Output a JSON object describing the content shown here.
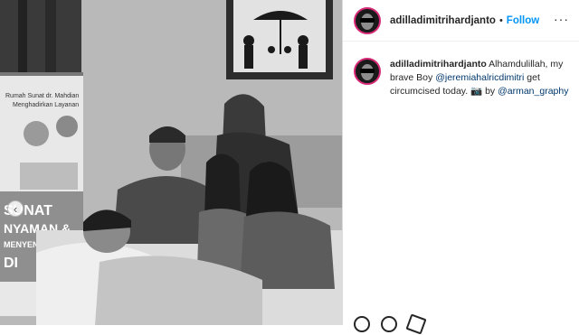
{
  "post": {
    "username": "adilladimitrihardjanto",
    "follow_label": "Follow",
    "separator": "•",
    "more_label": "···",
    "carousel_indicator": "‹"
  },
  "caption": {
    "username": "adilladimitrihardjanto",
    "text_1": " Alhamdulillah, my brave Boy ",
    "mention_1": "@jeremiahalricdimitri",
    "text_2": " get circumcised today. 📷 by ",
    "mention_2": "@arman_graphy"
  },
  "banner": {
    "line1": "Rumah Sunat dr. Mahdian",
    "line2": "Menghadirkan Layanan",
    "big1": "SUNAT",
    "big2": "NYAMAN &",
    "big3": "MENYENANGKAN",
    "big4": "DI"
  },
  "colors": {
    "follow": "#0095f6",
    "mention": "#00376b",
    "avatar_ring": "#d62976"
  },
  "icons": [
    "like-icon",
    "comment-icon",
    "share-icon",
    "more-icon",
    "carousel-prev-icon"
  ]
}
